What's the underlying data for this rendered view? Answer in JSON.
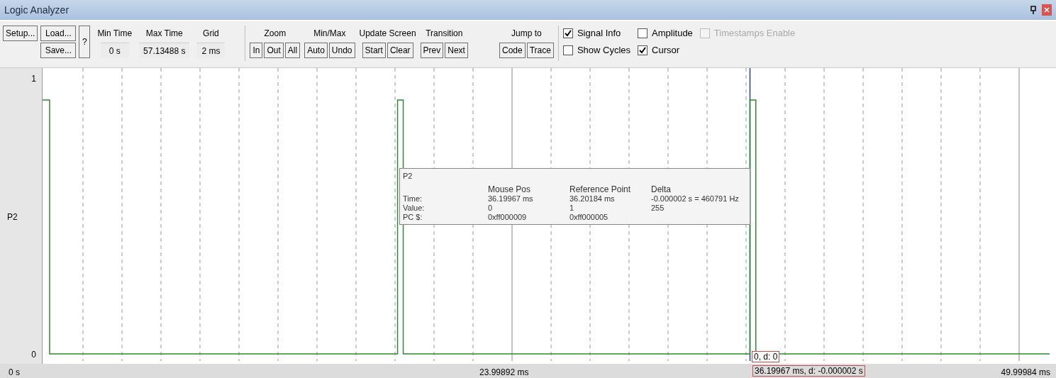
{
  "window": {
    "title": "Logic Analyzer"
  },
  "toolbar": {
    "setup": "Setup...",
    "load": "Load...",
    "save": "Save...",
    "help": "?",
    "fields": [
      {
        "label": "Min Time",
        "value": "0 s"
      },
      {
        "label": "Max Time",
        "value": "57.13488 s"
      },
      {
        "label": "Grid",
        "value": "2 ms"
      }
    ],
    "groups": [
      {
        "label": "Zoom",
        "buttons": [
          "In",
          "Out",
          "All"
        ]
      },
      {
        "label": "Min/Max",
        "buttons": [
          "Auto",
          "Undo"
        ]
      },
      {
        "label": "Update Screen",
        "buttons": [
          "Start",
          "Clear"
        ]
      },
      {
        "label": "Transition",
        "buttons": [
          "Prev",
          "Next"
        ]
      },
      {
        "label": "Jump to",
        "buttons": [
          "Code",
          "Trace"
        ]
      }
    ],
    "checkboxes": [
      {
        "label": "Signal Info",
        "checked": true,
        "disabled": false
      },
      {
        "label": "Show Cycles",
        "checked": false,
        "disabled": false
      },
      {
        "label": "Amplitude",
        "checked": false,
        "disabled": false
      },
      {
        "label": "Cursor",
        "checked": true,
        "disabled": false
      },
      {
        "label": "Timestamps Enable",
        "checked": false,
        "disabled": true
      }
    ]
  },
  "signal": {
    "name": "P2",
    "y_max": "1",
    "y_min": "0"
  },
  "info_popup": {
    "signal": "P2",
    "headers": [
      "Mouse Pos",
      "Reference Point",
      "Delta"
    ],
    "rows": [
      {
        "label": "Time:",
        "cells": [
          "36.19967 ms",
          "36.20184 ms",
          "-0.000002 s = 460791 Hz"
        ]
      },
      {
        "label": "Value:",
        "cells": [
          "0",
          "1",
          "255"
        ]
      },
      {
        "label": "PC $:",
        "cells": [
          "0xff000009",
          "0xff000005",
          ""
        ]
      }
    ]
  },
  "cursor_value": "0,  d: 0",
  "cursor_time": "36.19967 ms,  d: -0.000002 s",
  "time_axis": [
    "0 s",
    "23.99892 ms",
    "49.99984 ms"
  ]
}
